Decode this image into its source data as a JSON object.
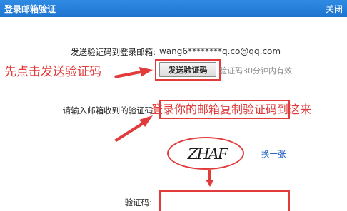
{
  "dialog": {
    "title": "登录邮箱验证",
    "close_label": "关闭"
  },
  "form": {
    "email_label": "发送验证码到登录邮箱:",
    "email_value": "wang6********q.co@qq.com",
    "send_button_label": "发送验证码",
    "validity_hint": "验证码30分钟内有效",
    "code_label": "请输入邮箱收到的验证码:",
    "code_value": "",
    "captcha_text": "ZHAF",
    "refresh_label": "换一张",
    "verify_label": "验证码:",
    "verify_value": ""
  },
  "annotations": {
    "step1": "先点击发送验证码",
    "step2": "登录你的邮箱复制验证码到这来"
  },
  "colors": {
    "title_bar": "#1f74cf",
    "annotation_red": "#e23b3b",
    "link_blue": "#1f5fbf"
  },
  "icons": [
    "arrow-icon"
  ]
}
